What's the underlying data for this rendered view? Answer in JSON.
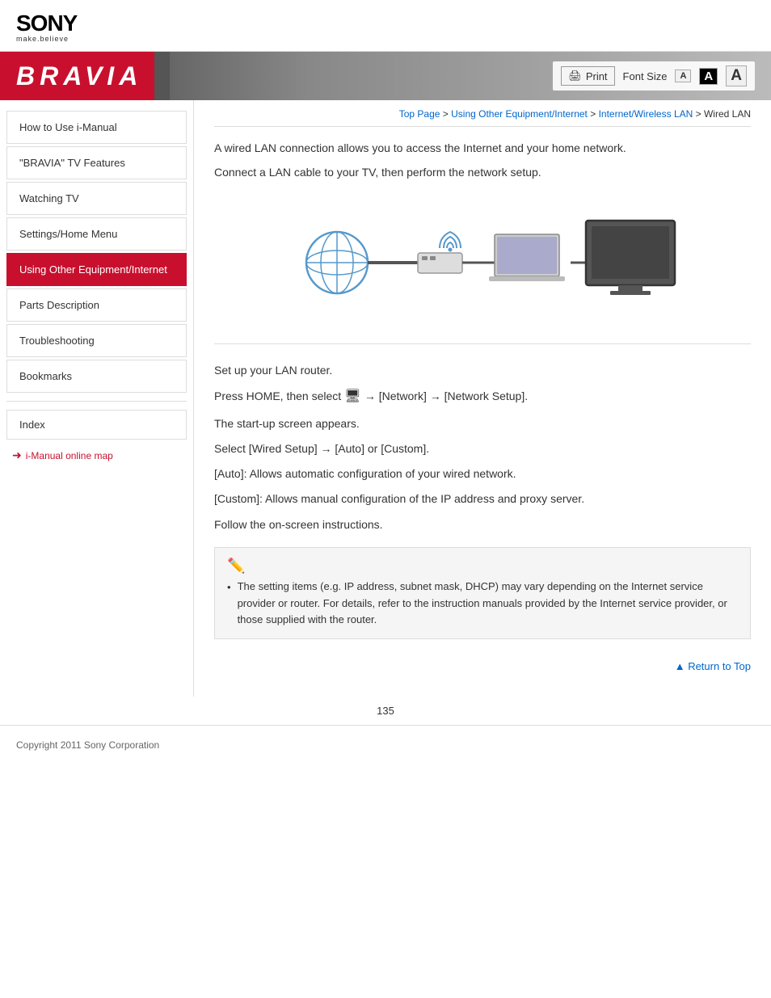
{
  "header": {
    "sony_text": "SONY",
    "sony_tagline": "make.believe",
    "bravia_title": "BRAVIA"
  },
  "toolbar": {
    "print_label": "Print",
    "font_size_label": "Font Size",
    "font_small": "A",
    "font_medium": "A",
    "font_large": "A"
  },
  "breadcrumb": {
    "top_page": "Top Page",
    "separator1": " > ",
    "using_other": "Using Other Equipment/Internet",
    "separator2": " > ",
    "internet_lan": "Internet/Wireless LAN",
    "separator3": " > ",
    "current": "Wired LAN"
  },
  "sidebar": {
    "items": [
      {
        "label": "How to Use i-Manual",
        "active": false
      },
      {
        "label": "\"BRAVIA\" TV Features",
        "active": false
      },
      {
        "label": "Watching TV",
        "active": false
      },
      {
        "label": "Settings/Home Menu",
        "active": false
      },
      {
        "label": "Using Other Equipment/Internet",
        "active": true
      },
      {
        "label": "Parts Description",
        "active": false
      },
      {
        "label": "Troubleshooting",
        "active": false
      },
      {
        "label": "Bookmarks",
        "active": false
      }
    ],
    "index_label": "Index",
    "online_map_label": "i-Manual online map"
  },
  "content": {
    "intro1": "A wired LAN connection allows you to access the Internet and your home network.",
    "intro2": "Connect a LAN cable to your TV, then perform the network setup.",
    "step1": "Set up your LAN router.",
    "step2_prefix": "Press HOME, then select",
    "step2_suffix": "→ [Network] → [Network Setup].",
    "step2_line2": "The start-up screen appears.",
    "step3": "Select [Wired Setup] → [Auto] or [Custom].",
    "step3_auto": "[Auto]: Allows automatic configuration of your wired network.",
    "step3_custom": "[Custom]: Allows manual configuration of the IP address and proxy server.",
    "step4": "Follow the on-screen instructions.",
    "note_text": "The setting items (e.g. IP address, subnet mask, DHCP) may vary depending on the Internet service provider or router. For details, refer to the instruction manuals provided by the Internet service provider, or those supplied with the router.",
    "return_top": "Return to Top"
  },
  "footer": {
    "copyright": "Copyright 2011 Sony Corporation",
    "page_number": "135"
  }
}
